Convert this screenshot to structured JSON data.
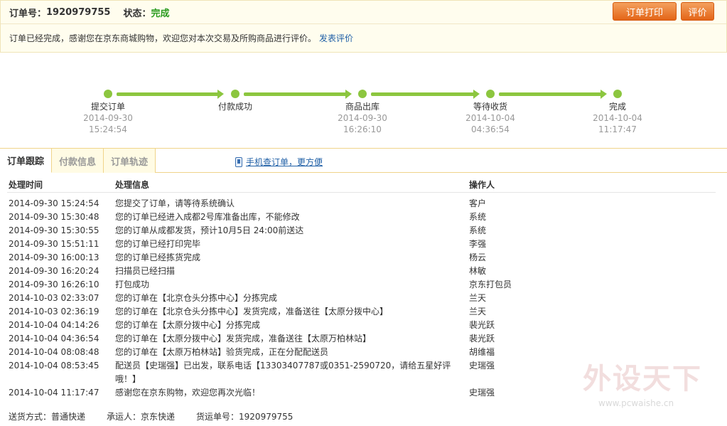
{
  "header": {
    "order_label": "订单号：",
    "order_no": "1920979755",
    "status_label": "状态：",
    "status_value": "完成",
    "print_button": "订单打印",
    "review_button": "评价",
    "message": "订单已经完成，感谢您在京东商城购物，欢迎您对本次交易及所购商品进行评价。",
    "review_link": "发表评价"
  },
  "progress": [
    {
      "name": "提交订单",
      "date": "2014-09-30",
      "time": "15:24:54"
    },
    {
      "name": "付款成功",
      "date": "",
      "time": ""
    },
    {
      "name": "商品出库",
      "date": "2014-09-30",
      "time": "16:26:10"
    },
    {
      "name": "等待收货",
      "date": "2014-10-04",
      "time": "04:36:54"
    },
    {
      "name": "完成",
      "date": "2014-10-04",
      "time": "11:17:47"
    }
  ],
  "tabs": [
    {
      "label": "订单跟踪",
      "active": true
    },
    {
      "label": "付款信息",
      "active": false
    },
    {
      "label": "订单轨迹",
      "active": false
    }
  ],
  "phone_link": "手机查订单，更方便",
  "table": {
    "headers": [
      "处理时间",
      "处理信息",
      "操作人"
    ],
    "rows": [
      [
        "2014-09-30 15:24:54",
        "您提交了订单，请等待系统确认",
        "客户"
      ],
      [
        "2014-09-30 15:30:48",
        "您的订单已经进入成都2号库准备出库，不能修改",
        "系统"
      ],
      [
        "2014-09-30 15:30:55",
        "您的订单从成都发货，预计10月5日 24:00前送达",
        "系统"
      ],
      [
        "2014-09-30 15:51:11",
        "您的订单已经打印完毕",
        "李强"
      ],
      [
        "2014-09-30 16:00:13",
        "您的订单已经拣货完成",
        "杨云"
      ],
      [
        "2014-09-30 16:20:24",
        "扫描员已经扫描",
        "林敏"
      ],
      [
        "2014-09-30 16:26:10",
        "打包成功",
        "京东打包员"
      ],
      [
        "2014-10-03 02:33:07",
        "您的订单在【北京仓头分拣中心】分拣完成",
        "兰天"
      ],
      [
        "2014-10-03 02:36:19",
        "您的订单在【北京仓头分拣中心】发货完成，准备送往【太原分拨中心】",
        "兰天"
      ],
      [
        "2014-10-04 04:14:26",
        "您的订单在【太原分拨中心】分拣完成",
        "裴光跃"
      ],
      [
        "2014-10-04 04:36:54",
        "您的订单在【太原分拨中心】发货完成，准备送往【太原万柏林站】",
        "裴光跃"
      ],
      [
        "2014-10-04 08:08:48",
        "您的订单在【太原万柏林站】验货完成，正在分配配送员",
        "胡维福"
      ],
      [
        "2014-10-04 08:53:45",
        "配送员【史瑞强】已出发，联系电话【13303407787或0351-2590720，请给五星好评哦！】",
        "史瑞强"
      ],
      [
        "2014-10-04 11:17:47",
        "感谢您在京东购物，欢迎您再次光临！",
        "史瑞强"
      ]
    ]
  },
  "footer": {
    "shipping_method": "送货方式：普通快递",
    "carrier": "承运人：京东快递",
    "waybill": "货运单号：1920979755"
  },
  "watermark": {
    "big": "外设天下",
    "small": "www.pcwaishe.cn"
  },
  "colors": {
    "accent_orange": "#e36518",
    "status_green": "#2a9b1f",
    "progress_green": "#8cc63f",
    "link_blue": "#1f5fa6"
  }
}
